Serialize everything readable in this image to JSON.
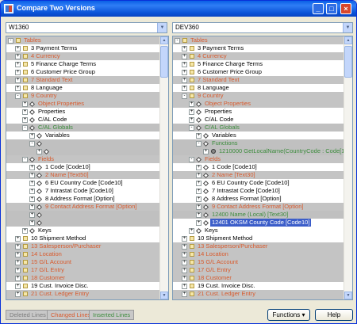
{
  "window": {
    "title": "Compare Two Versions"
  },
  "left": {
    "version": "W1360",
    "rows": [
      {
        "indent": 0,
        "exp": "-",
        "icon": "folder",
        "label": "Tables",
        "status": "changed"
      },
      {
        "indent": 1,
        "exp": "+",
        "icon": "folder",
        "label": "3 Payment Terms",
        "status": ""
      },
      {
        "indent": 1,
        "exp": "+",
        "icon": "folder",
        "label": "4 Currency",
        "status": "changed"
      },
      {
        "indent": 1,
        "exp": "+",
        "icon": "folder",
        "label": "5 Finance Charge Terms",
        "status": ""
      },
      {
        "indent": 1,
        "exp": "+",
        "icon": "folder",
        "label": "6 Customer Price Group",
        "status": ""
      },
      {
        "indent": 1,
        "exp": "+",
        "icon": "folder",
        "label": "7 Standard Text",
        "status": "changed"
      },
      {
        "indent": 1,
        "exp": "+",
        "icon": "folder",
        "label": "8 Language",
        "status": ""
      },
      {
        "indent": 1,
        "exp": "-",
        "icon": "folder",
        "label": "9 Country",
        "status": "changed"
      },
      {
        "indent": 2,
        "exp": "+",
        "icon": "diamond",
        "label": "Object Properties",
        "status": "changed"
      },
      {
        "indent": 2,
        "exp": "+",
        "icon": "diamond",
        "label": "Properties",
        "status": ""
      },
      {
        "indent": 2,
        "exp": "+",
        "icon": "diamond",
        "label": "C/AL Code",
        "status": ""
      },
      {
        "indent": 2,
        "exp": "-",
        "icon": "diamond",
        "label": "C/AL Globals",
        "status": "inserted"
      },
      {
        "indent": 3,
        "exp": "+",
        "icon": "diamond",
        "label": "Variables",
        "status": ""
      },
      {
        "indent": 3,
        "exp": "-",
        "icon": "diamond",
        "label": "",
        "status": "deleted"
      },
      {
        "indent": 4,
        "exp": "+",
        "icon": "diamond",
        "label": "",
        "status": "deleted"
      },
      {
        "indent": 2,
        "exp": "-",
        "icon": "diamond",
        "label": "Fields",
        "status": "changed"
      },
      {
        "indent": 3,
        "exp": "+",
        "icon": "diamond",
        "label": "1 Code  [Code10]",
        "status": ""
      },
      {
        "indent": 3,
        "exp": "+",
        "icon": "diamond",
        "label": "2 Name  [Text50]",
        "status": "changed"
      },
      {
        "indent": 3,
        "exp": "+",
        "icon": "diamond",
        "label": "6 EU Country Code  [Code10]",
        "status": ""
      },
      {
        "indent": 3,
        "exp": "+",
        "icon": "diamond",
        "label": "7 Intrastat Code  [Code10]",
        "status": ""
      },
      {
        "indent": 3,
        "exp": "+",
        "icon": "diamond",
        "label": "8 Address Format  [Option]",
        "status": ""
      },
      {
        "indent": 3,
        "exp": "+",
        "icon": "diamond",
        "label": "9 Contact Address Format  [Option]",
        "status": "changed"
      },
      {
        "indent": 3,
        "exp": "+",
        "icon": "diamond",
        "label": "",
        "status": "deleted"
      },
      {
        "indent": 3,
        "exp": "+",
        "icon": "diamond",
        "label": "",
        "status": "deleted"
      },
      {
        "indent": 2,
        "exp": "+",
        "icon": "diamond",
        "label": "Keys",
        "status": ""
      },
      {
        "indent": 1,
        "exp": "+",
        "icon": "folder",
        "label": "10 Shipment Method",
        "status": ""
      },
      {
        "indent": 1,
        "exp": "+",
        "icon": "folder",
        "label": "13 Salesperson/Purchaser",
        "status": "changed"
      },
      {
        "indent": 1,
        "exp": "+",
        "icon": "folder",
        "label": "14 Location",
        "status": "changed"
      },
      {
        "indent": 1,
        "exp": "+",
        "icon": "folder",
        "label": "15 G/L Account",
        "status": "changed"
      },
      {
        "indent": 1,
        "exp": "+",
        "icon": "folder",
        "label": "17 G/L Entry",
        "status": "changed"
      },
      {
        "indent": 1,
        "exp": "+",
        "icon": "folder",
        "label": "18 Customer",
        "status": "changed"
      },
      {
        "indent": 1,
        "exp": "+",
        "icon": "folder",
        "label": "19 Cust. Invoice Disc.",
        "status": ""
      },
      {
        "indent": 1,
        "exp": "+",
        "icon": "folder",
        "label": "21 Cust. Ledger Entry",
        "status": "changed"
      },
      {
        "indent": 1,
        "exp": "+",
        "icon": "folder",
        "label": "23 Vendor",
        "status": "changed"
      }
    ]
  },
  "right": {
    "version": "DEV360",
    "rows": [
      {
        "indent": 0,
        "exp": "-",
        "icon": "folder",
        "label": "Tables",
        "status": "changed"
      },
      {
        "indent": 1,
        "exp": "+",
        "icon": "folder",
        "label": "3 Payment Terms",
        "status": ""
      },
      {
        "indent": 1,
        "exp": "+",
        "icon": "folder",
        "label": "4 Currency",
        "status": "changed"
      },
      {
        "indent": 1,
        "exp": "+",
        "icon": "folder",
        "label": "5 Finance Charge Terms",
        "status": ""
      },
      {
        "indent": 1,
        "exp": "+",
        "icon": "folder",
        "label": "6 Customer Price Group",
        "status": ""
      },
      {
        "indent": 1,
        "exp": "+",
        "icon": "folder",
        "label": "7 Standard Text",
        "status": "changed"
      },
      {
        "indent": 1,
        "exp": "+",
        "icon": "folder",
        "label": "8 Language",
        "status": ""
      },
      {
        "indent": 1,
        "exp": "-",
        "icon": "folder",
        "label": "9 Country",
        "status": "changed"
      },
      {
        "indent": 2,
        "exp": "+",
        "icon": "diamond",
        "label": "Object Properties",
        "status": "changed"
      },
      {
        "indent": 2,
        "exp": "+",
        "icon": "diamond",
        "label": "Properties",
        "status": ""
      },
      {
        "indent": 2,
        "exp": "+",
        "icon": "diamond",
        "label": "C/AL Code",
        "status": ""
      },
      {
        "indent": 2,
        "exp": "-",
        "icon": "diamond",
        "label": "C/AL Globals",
        "status": "inserted"
      },
      {
        "indent": 3,
        "exp": "+",
        "icon": "diamond",
        "label": "Variables",
        "status": ""
      },
      {
        "indent": 3,
        "exp": "-",
        "icon": "diamond",
        "label": "Functions",
        "status": "inserted"
      },
      {
        "indent": 4,
        "exp": "+",
        "icon": "gear",
        "label": "1210000 GetLocalName(CountryCode : Code[10]) : Re",
        "status": "inserted"
      },
      {
        "indent": 2,
        "exp": "-",
        "icon": "diamond",
        "label": "Fields",
        "status": "changed"
      },
      {
        "indent": 3,
        "exp": "+",
        "icon": "diamond",
        "label": "1 Code  [Code10]",
        "status": ""
      },
      {
        "indent": 3,
        "exp": "+",
        "icon": "diamond",
        "label": "2 Name  [Text30]",
        "status": "changed"
      },
      {
        "indent": 3,
        "exp": "+",
        "icon": "diamond",
        "label": "6 EU Country Code  [Code10]",
        "status": ""
      },
      {
        "indent": 3,
        "exp": "+",
        "icon": "diamond",
        "label": "7 Intrastat Code  [Code10]",
        "status": ""
      },
      {
        "indent": 3,
        "exp": "+",
        "icon": "diamond",
        "label": "8 Address Format  [Option]",
        "status": ""
      },
      {
        "indent": 3,
        "exp": "+",
        "icon": "diamond",
        "label": "9 Contact Address Format  [Option]",
        "status": "changed"
      },
      {
        "indent": 3,
        "exp": "+",
        "icon": "diamond",
        "label": "12400 Name (Local)  [Text30]",
        "status": "inserted"
      },
      {
        "indent": 3,
        "exp": "+",
        "icon": "diamond",
        "label": "12401 OKSM County Code  [Code10]",
        "status": "selected"
      },
      {
        "indent": 2,
        "exp": "+",
        "icon": "diamond",
        "label": "Keys",
        "status": ""
      },
      {
        "indent": 1,
        "exp": "+",
        "icon": "folder",
        "label": "10 Shipment Method",
        "status": ""
      },
      {
        "indent": 1,
        "exp": "+",
        "icon": "folder",
        "label": "13 Salesperson/Purchaser",
        "status": "changed"
      },
      {
        "indent": 1,
        "exp": "+",
        "icon": "folder",
        "label": "14 Location",
        "status": "changed"
      },
      {
        "indent": 1,
        "exp": "+",
        "icon": "folder",
        "label": "15 G/L Account",
        "status": "changed"
      },
      {
        "indent": 1,
        "exp": "+",
        "icon": "folder",
        "label": "17 G/L Entry",
        "status": "changed"
      },
      {
        "indent": 1,
        "exp": "+",
        "icon": "folder",
        "label": "18 Customer",
        "status": "changed"
      },
      {
        "indent": 1,
        "exp": "+",
        "icon": "folder",
        "label": "19 Cust. Invoice Disc.",
        "status": ""
      },
      {
        "indent": 1,
        "exp": "+",
        "icon": "folder",
        "label": "21 Cust. Ledger Entry",
        "status": "changed"
      },
      {
        "indent": 1,
        "exp": "+",
        "icon": "folder",
        "label": "23 Vendor",
        "status": "changed"
      }
    ]
  },
  "legend": {
    "deleted": "Deleted Lines",
    "changed": "Changed Lines",
    "inserted": "Inserted Lines"
  },
  "buttons": {
    "functions": "Functions ▾",
    "help": "Help"
  },
  "colors": {
    "deleted_text": "#7d7d7d",
    "changed_text": "#d85b2e",
    "inserted_text": "#3d8c3d",
    "selection": "#3b5dc9"
  }
}
